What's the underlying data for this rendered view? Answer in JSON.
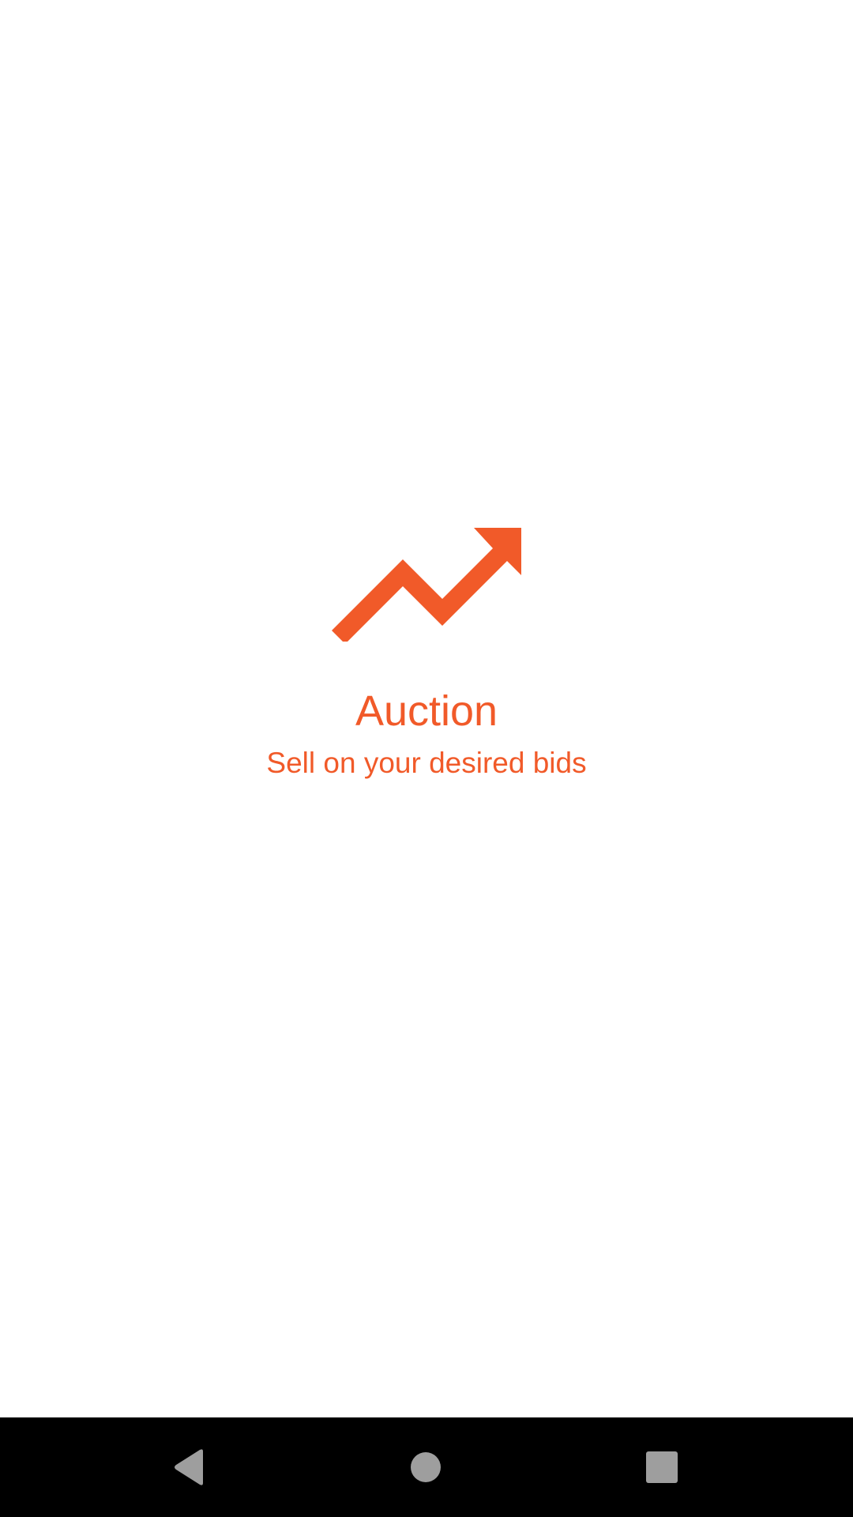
{
  "onboarding": {
    "icon": "trending-up-icon",
    "title": "Auction",
    "subtitle": "Sell on your desired bids"
  },
  "navigation_bar": {
    "back_icon": "back-icon",
    "home_icon": "home-icon",
    "recents_icon": "recents-icon"
  },
  "colors": {
    "accent": "#F15A29",
    "background": "#FFFFFF",
    "nav_background": "#000000",
    "nav_icons": "#9E9E9E"
  }
}
